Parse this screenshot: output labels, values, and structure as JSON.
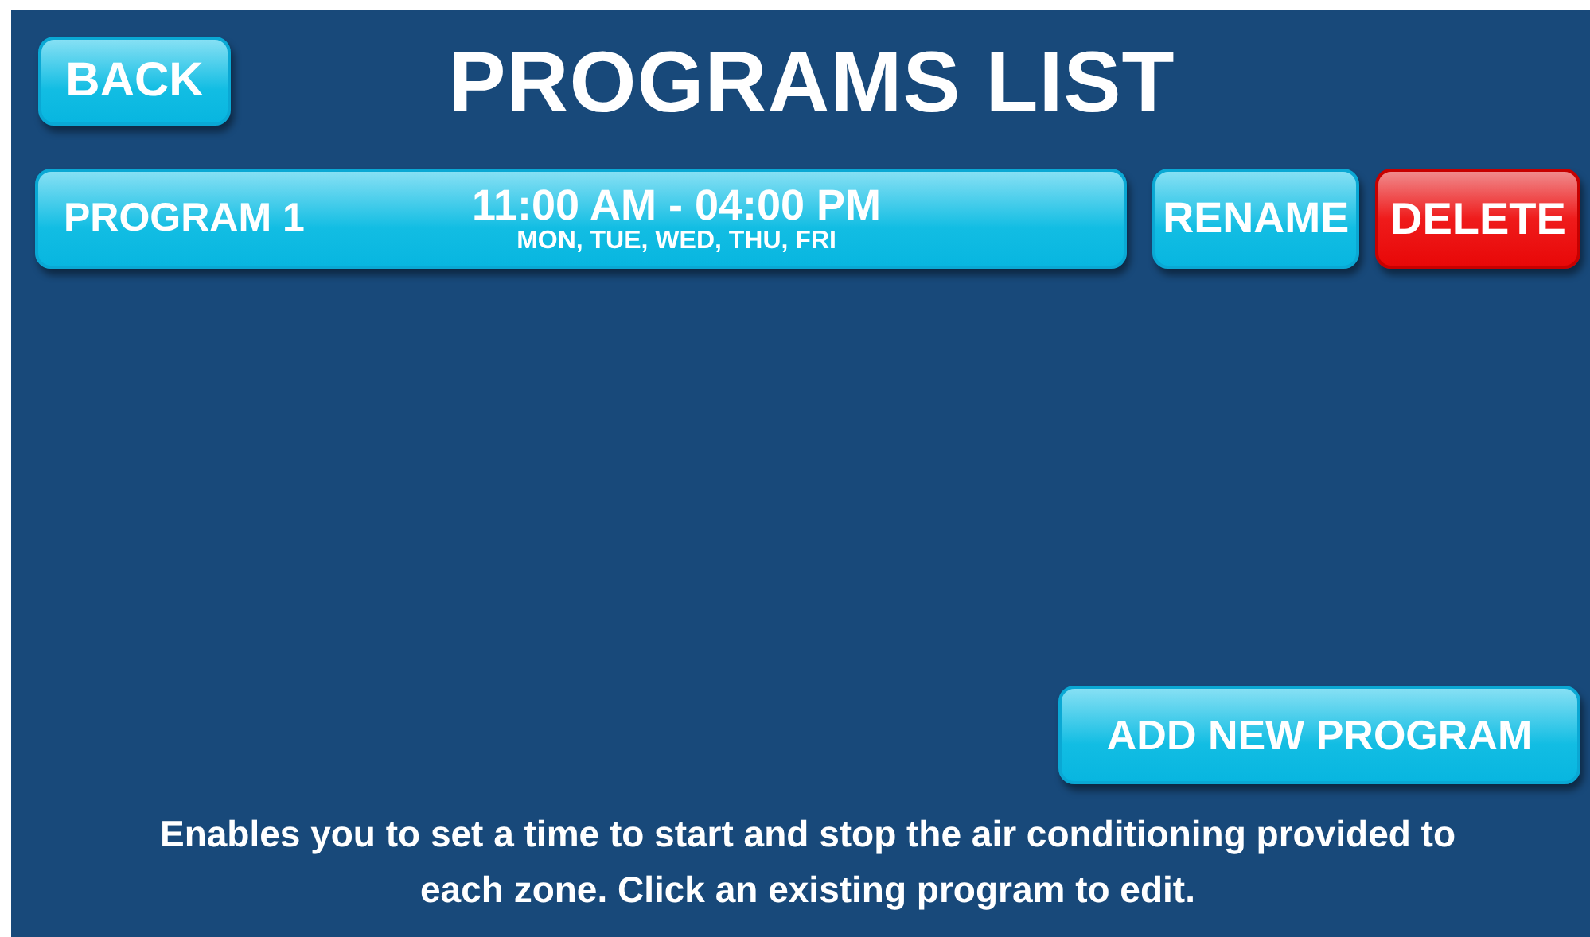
{
  "header": {
    "back_button": "BACK",
    "title": "PROGRAMS LIST"
  },
  "programs": [
    {
      "name": "PROGRAM 1",
      "time": "11:00 AM - 04:00 PM",
      "days": "MON, TUE, WED, THU, FRI",
      "rename_button": "RENAME",
      "delete_button": "DELETE"
    }
  ],
  "add_button": "ADD NEW PROGRAM",
  "description": "Enables you to set a time to start and stop the air conditioning provided to each zone. Click an existing program to edit."
}
